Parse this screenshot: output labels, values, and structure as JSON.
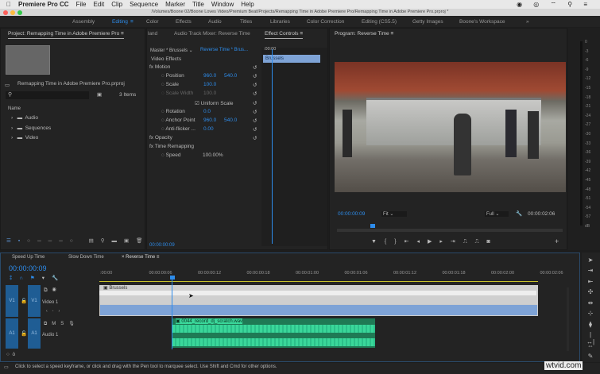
{
  "menubar": {
    "app": "Premiere Pro CC",
    "items": [
      "File",
      "Edit",
      "Clip",
      "Sequence",
      "Marker",
      "Title",
      "Window",
      "Help"
    ]
  },
  "title": "/Volumes/Boone 02/Boone Loves Video/Premium Beat/Projects/Remapping Time in Adobe Premiere Pro/Remapping Time in Adobe Premiere Pro.prproj *",
  "workspaces": [
    "Assembly",
    "Editing",
    "Color",
    "Effects",
    "Audio",
    "Titles",
    "Libraries",
    "Color Correction",
    "Editing (CS5.5)",
    "Getty Images",
    "Boone's Workspace"
  ],
  "project": {
    "tab": "Project: Remapping Time in Adobe Premiere Pro",
    "file": "Remapping Time in Adobe Premiere Pro.prproj",
    "count": "3 Items",
    "col": "Name",
    "items": [
      "Audio",
      "Sequences",
      "Video"
    ]
  },
  "tabs": {
    "land": "land",
    "mixer": "Audio Track Mixer: Reverse Time",
    "effects": "Effect Controls",
    "program": "Program: Reverse Time"
  },
  "effects": {
    "master": "Master * Brussels",
    "seq": "Reverse Time * Brus...",
    "section": "Video Effects",
    "clip": "Brussels",
    "ruler": ":00:00",
    "timecode": "00:00:00:09",
    "rows": [
      {
        "label": "Motion",
        "v1": "",
        "v2": ""
      },
      {
        "label": "Position",
        "v1": "960.0",
        "v2": "540.0"
      },
      {
        "label": "Scale",
        "v1": "100.0",
        "v2": ""
      },
      {
        "label": "Scale Width",
        "v1": "100.0",
        "v2": ""
      },
      {
        "label": "Uniform Scale",
        "v1": "",
        "v2": ""
      },
      {
        "label": "Rotation",
        "v1": "0.0",
        "v2": ""
      },
      {
        "label": "Anchor Point",
        "v1": "960.0",
        "v2": "540.0"
      },
      {
        "label": "Anti-flicker ...",
        "v1": "0.00",
        "v2": ""
      },
      {
        "label": "Opacity",
        "v1": "",
        "v2": ""
      },
      {
        "label": "Time Remapping",
        "v1": "",
        "v2": ""
      },
      {
        "label": "Speed",
        "v1": "100.00%",
        "v2": ""
      }
    ]
  },
  "program": {
    "timecode": "00:00:00:09",
    "fit": "Fit",
    "quality": "Full",
    "duration": "00:00:02:06"
  },
  "meter": [
    "0",
    "-3",
    "-6",
    "-9",
    "-12",
    "-15",
    "-18",
    "-21",
    "-24",
    "-27",
    "-30",
    "-33",
    "-36",
    "-39",
    "-42",
    "-45",
    "-48",
    "-51",
    "-54",
    "-57",
    "dB"
  ],
  "timeline": {
    "tabs": [
      "Speed Up Time",
      "Slow Down Time",
      "Reverse Time"
    ],
    "timecode": "00:00:00:09",
    "ruler": [
      ":00:00",
      "00:00:00:06",
      "00:00:00:12",
      "00:00:00:18",
      "00:00:01:00",
      "00:00:01:06",
      "00:00:01:12",
      "00:00:01:18",
      "00:00:02:00",
      "00:00:02:06"
    ],
    "v1": "V1",
    "video": "Video 1",
    "a1": "A1",
    "audio": "Audio 1",
    "vclip": "Brussels",
    "aclip": "0044_record_dj_scratch.wav"
  },
  "status": "Click to select a speed keyframe, or click and drag with the Pen tool to marquee select. Use Shift and Cmd for other options.",
  "watermark": "wtvid.com",
  "colors": {
    "accent": "#2d8ceb",
    "audio": "#1f7a55",
    "video": "#7ea3d6"
  }
}
